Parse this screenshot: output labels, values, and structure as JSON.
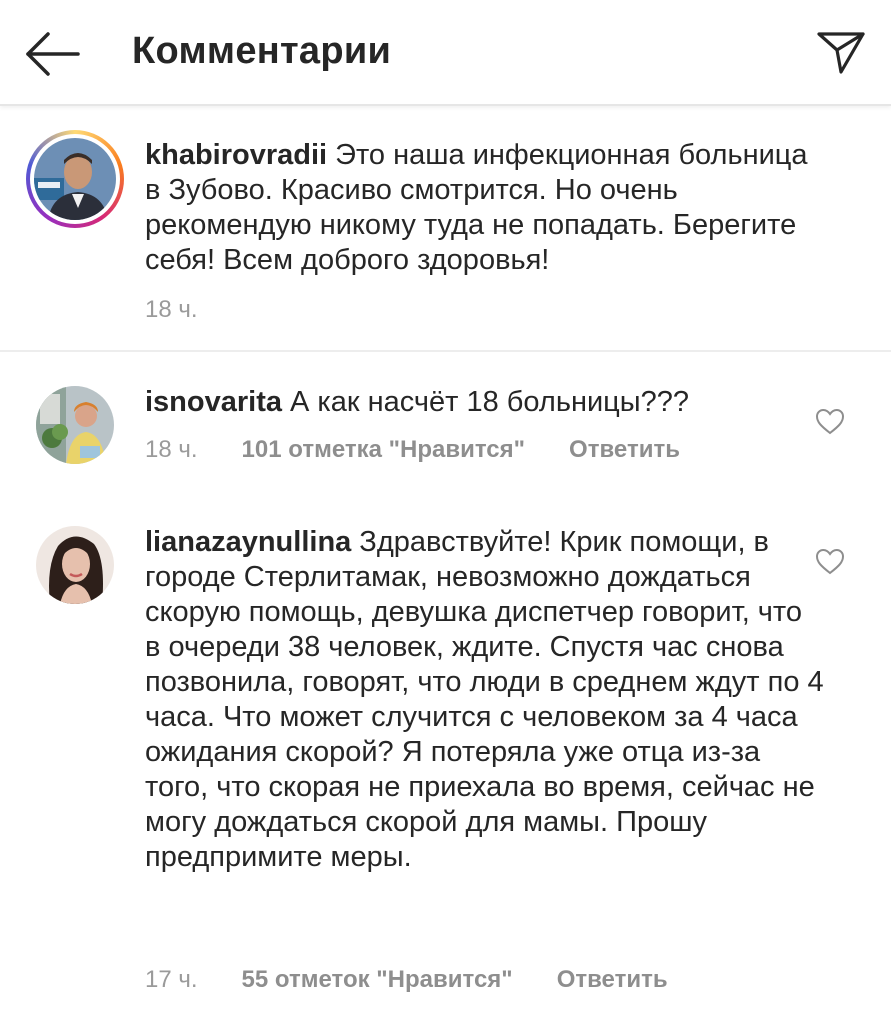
{
  "header": {
    "title": "Комментарии",
    "back_icon": "arrow-left-icon",
    "send_icon": "paper-plane-icon"
  },
  "comments": [
    {
      "username": "khabirovradii",
      "text": "Это наша инфекционная больница в Зубово. Красиво смотрится. Но очень рекомендую никому туда не попадать. Берегите себя! Всем доброго здоровья!",
      "time": "18 ч.",
      "has_story_ring": true
    },
    {
      "username": "isnovarita",
      "text": "А как насчёт 18 больницы???",
      "time": "18 ч.",
      "likes": "101 отметка \"Нравится\"",
      "reply": "Ответить"
    },
    {
      "username": "lianazaynullina",
      "text": "Здравствуйте! Крик помощи, в городе Стерлитамак, невозможно дождаться скорую помощь, девушка диспетчер говорит, что в очереди 38 человек, ждите. Спустя  час снова позвонила, говорят, что люди в среднем ждут по 4 часа. Что может случится с человеком за 4 часа ожидания скорой? Я потеряла уже отца из-за того, что скорая не приехала во время, сейчас не могу дождаться скорой для мамы. Прошу предпримите меры.",
      "time": "17 ч.",
      "likes": "55 отметок \"Нравится\"",
      "reply": "Ответить"
    }
  ],
  "colors": {
    "text": "#262626",
    "secondary": "#8e8e8e",
    "divider": "#ededed"
  }
}
